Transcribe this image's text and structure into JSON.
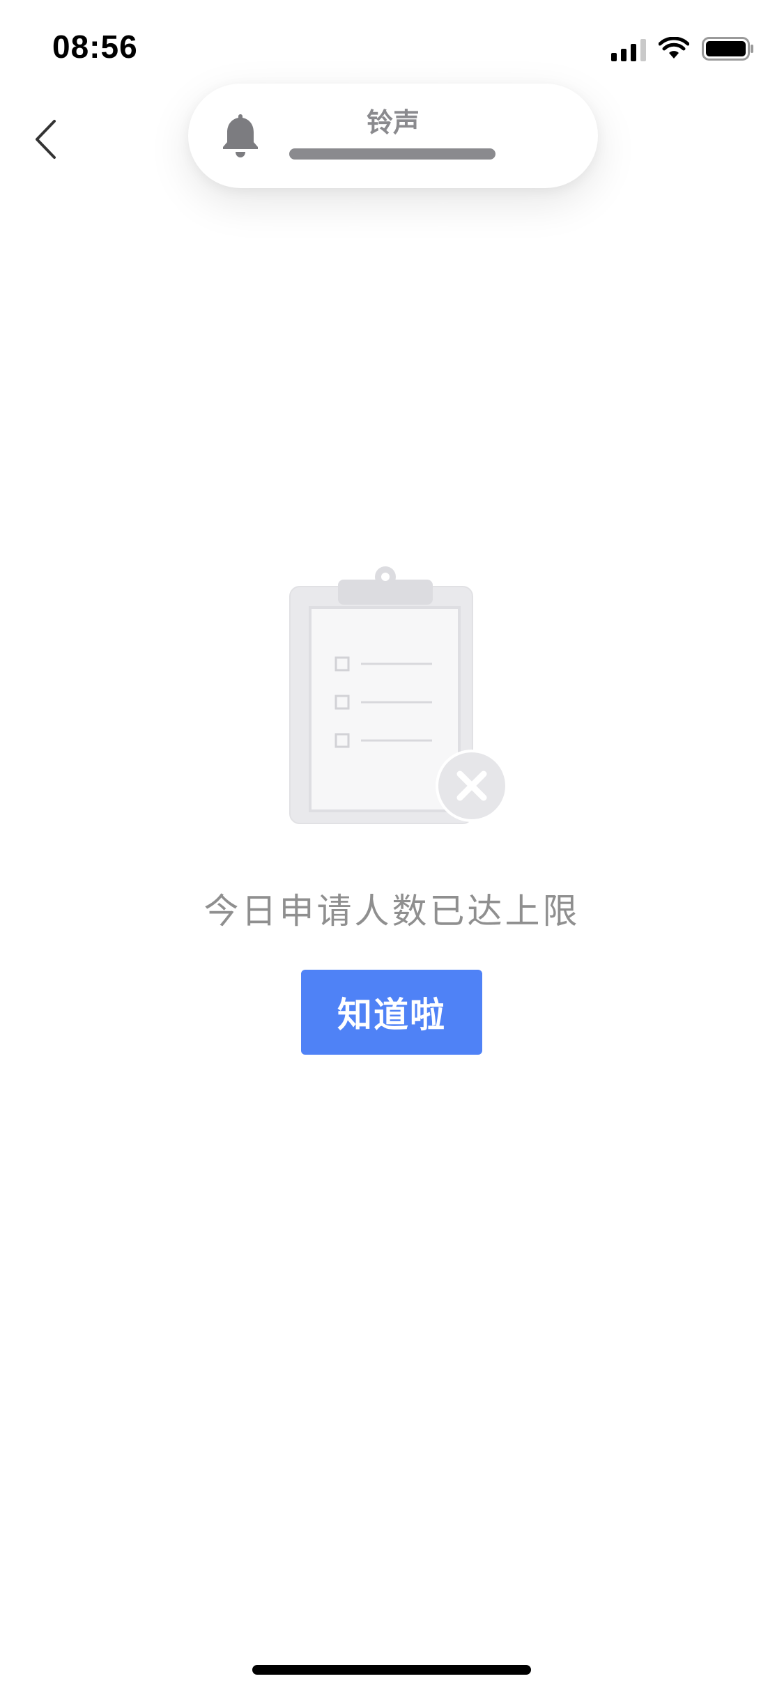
{
  "status_bar": {
    "time": "08:56",
    "signal_icon": "cellular-signal-icon",
    "wifi_icon": "wifi-icon",
    "battery_icon": "battery-icon"
  },
  "nav": {
    "back_icon": "chevron-left-icon"
  },
  "ringtone": {
    "icon": "bell-icon",
    "label": "铃声",
    "level": 1.0
  },
  "empty_state": {
    "illustration": "clipboard-error-icon",
    "message": "今日申请人数已达上限",
    "button_label": "知道啦"
  },
  "colors": {
    "accent": "#4f82f6",
    "message_text": "#8f8f8f",
    "pill_text": "#8a8a8e"
  }
}
